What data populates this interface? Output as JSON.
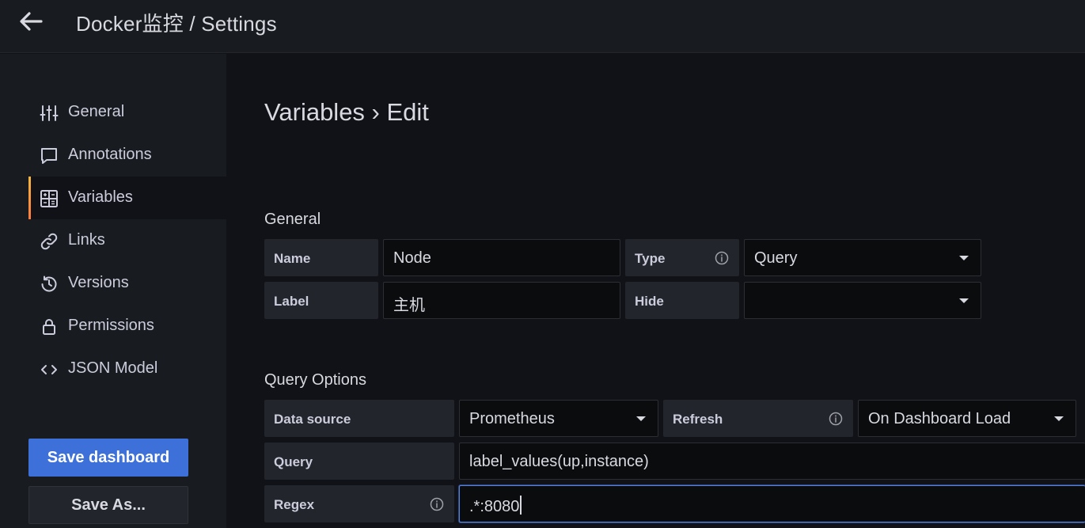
{
  "header": {
    "title": "Docker监控 / Settings"
  },
  "sidebar": {
    "items": [
      {
        "label": "General",
        "icon": "sliders-icon"
      },
      {
        "label": "Annotations",
        "icon": "comment-icon"
      },
      {
        "label": "Variables",
        "icon": "calculator-icon",
        "active": true
      },
      {
        "label": "Links",
        "icon": "link-icon"
      },
      {
        "label": "Versions",
        "icon": "history-icon"
      },
      {
        "label": "Permissions",
        "icon": "lock-icon"
      },
      {
        "label": "JSON Model",
        "icon": "code-icon"
      }
    ],
    "save_label": "Save dashboard",
    "save_as_label": "Save As..."
  },
  "main": {
    "heading": "Variables › Edit",
    "general": {
      "title": "General",
      "name_label": "Name",
      "name_value": "Node",
      "type_label": "Type",
      "type_value": "Query",
      "label_label": "Label",
      "label_value": "主机",
      "hide_label": "Hide",
      "hide_value": ""
    },
    "query_options": {
      "title": "Query Options",
      "datasource_label": "Data source",
      "datasource_value": "Prometheus",
      "refresh_label": "Refresh",
      "refresh_value": "On Dashboard Load",
      "query_label": "Query",
      "query_value": "label_values(up,instance)",
      "regex_label": "Regex",
      "regex_value": ".*:8080"
    }
  },
  "colors": {
    "accent": "#3d71d9",
    "active_bar": "#f5b73d",
    "background": "#111217",
    "panel": "#181b1f"
  }
}
